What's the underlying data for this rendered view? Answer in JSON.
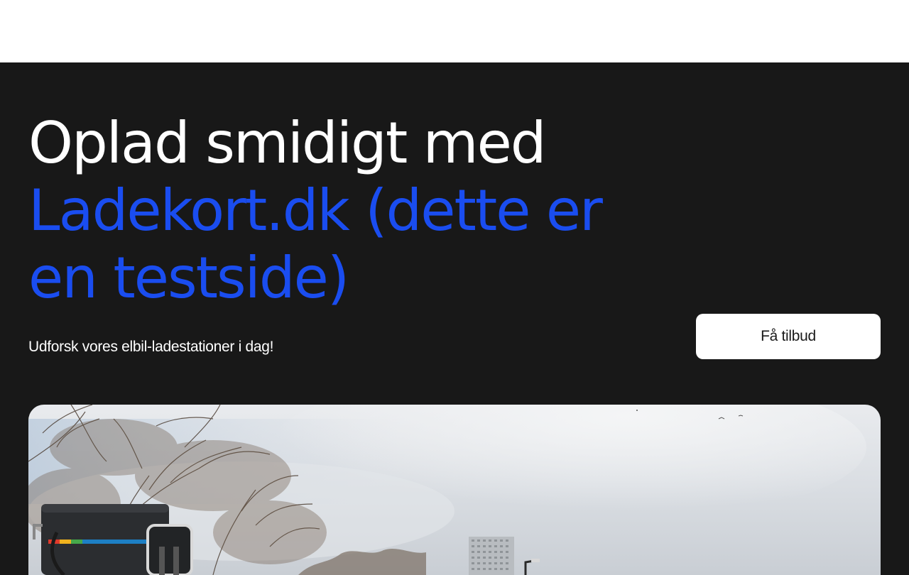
{
  "hero": {
    "title_line1": "Oplad smidigt med",
    "title_accent": "Ladekort.dk (dette er en testside)",
    "subtitle": "Udforsk vores elbil-ladestationer i dag!",
    "cta_label": "Få tilbud"
  },
  "colors": {
    "background": "#181818",
    "header": "#ffffff",
    "accent": "#1a4df0",
    "button_bg": "#ffffff",
    "button_text": "#1a1a1a"
  }
}
